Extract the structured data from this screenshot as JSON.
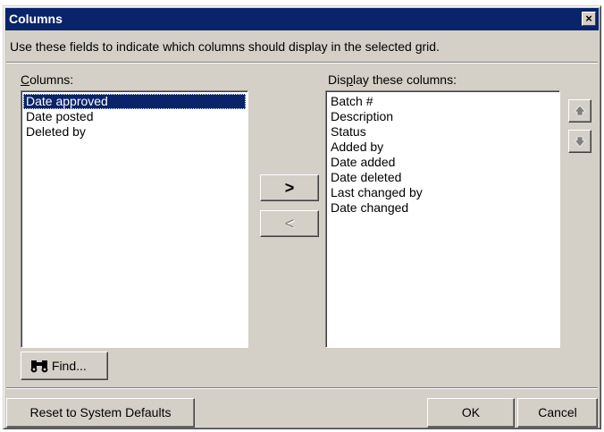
{
  "window": {
    "title": "Columns",
    "close_glyph": "×"
  },
  "instructions": "Use these fields to indicate which columns should display in the selected grid.",
  "available": {
    "label_mnemonic": "C",
    "label_rest": "olumns:",
    "items": [
      "Date approved",
      "Date posted",
      "Deleted by"
    ],
    "selected_index": 0
  },
  "displayed": {
    "label_pre": "Dis",
    "label_mnemonic": "p",
    "label_post": "lay these columns:",
    "items": [
      "Batch #",
      "Description",
      "Status",
      "Added by",
      "Date added",
      "Date deleted",
      "Last changed by",
      "Date changed"
    ]
  },
  "transfer": {
    "add_glyph": ">",
    "remove_glyph": "<"
  },
  "order": {
    "up_icon": "arrow-up-icon",
    "down_icon": "arrow-down-icon"
  },
  "find": {
    "icon": "binoculars-icon",
    "label": "Find..."
  },
  "footer": {
    "reset_label": "Reset to System Defaults",
    "ok_label": "OK",
    "cancel_label": "Cancel"
  },
  "colors": {
    "titlebar": "#0a246a",
    "face": "#d4d0c8",
    "selection": "#0a246a"
  }
}
